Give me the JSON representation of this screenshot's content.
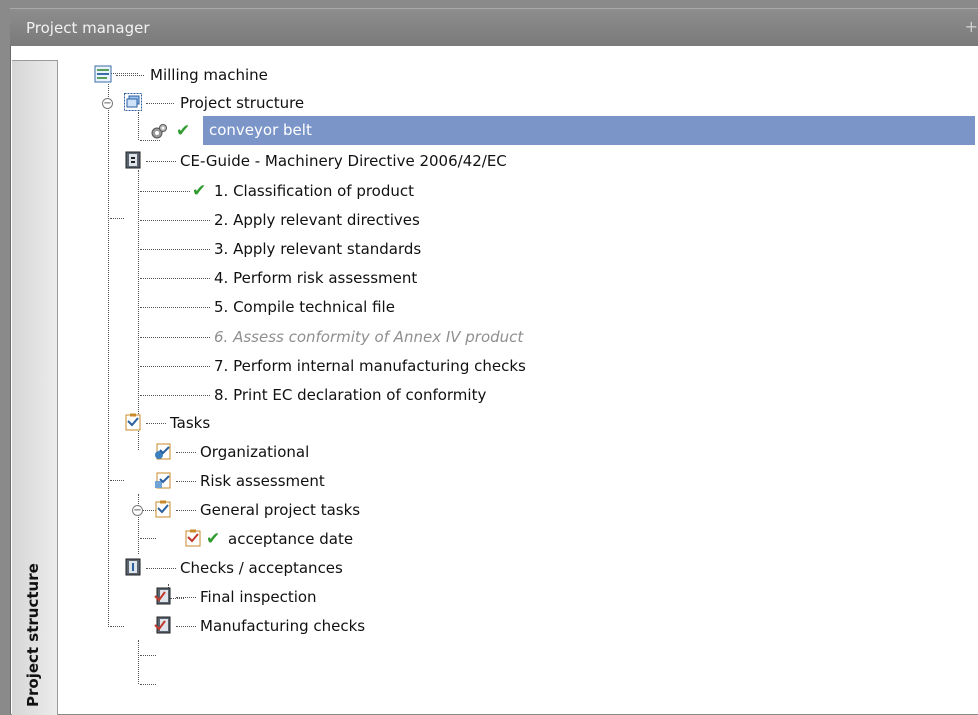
{
  "window": {
    "title": "Project manager",
    "pin_glyph": "+"
  },
  "side_tab": {
    "label": "Project structure"
  },
  "tree": {
    "root": "Milling machine",
    "project_structure": "Project structure",
    "selected_item": "conveyor belt",
    "guide": "CE-Guide - Machinery Directive 2006/42/EC",
    "steps": [
      "1. Classification of product",
      "2. Apply relevant directives",
      "3. Apply relevant standards",
      "4. Perform risk assessment",
      "5. Compile technical file",
      "6. Assess conformity of Annex IV product",
      "7. Perform internal manufacturing checks",
      "8. Print EC declaration of conformity"
    ],
    "tasks": "Tasks",
    "task_items": [
      "Organizational",
      "Risk assessment",
      "General project tasks"
    ],
    "acceptance": "acceptance date",
    "checks": "Checks / acceptances",
    "check_items": [
      "Final inspection",
      "Manufacturing checks"
    ]
  },
  "icons": {
    "root": "project-icon",
    "structure": "structure-icon",
    "gear": "gear-icon",
    "check": "checkmark-icon",
    "book": "book-icon",
    "task": "task-clipboard-icon",
    "checks": "checks-clipboard-icon"
  },
  "colors": {
    "selection": "#7b95c9",
    "check": "#2f9b2f",
    "disabled_text": "#8f8f8f"
  }
}
